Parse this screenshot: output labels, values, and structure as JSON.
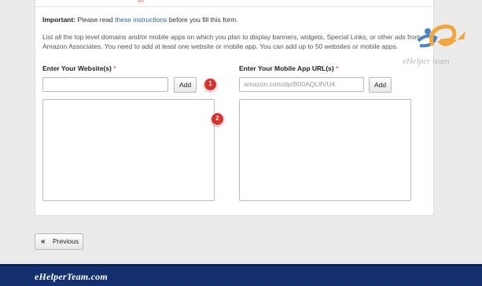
{
  "form": {
    "important_label": "Important:",
    "important_text_before": "Please read",
    "important_link": "these instructions",
    "important_text_after": "before you fill this form.",
    "desc_line1": "List all the top level domains and/or mobile apps on which you plan to display banners, widgets, Special Links, or other ads from",
    "desc_line2": "Amazon Associates. You need to add at least one website or mobile app. You can add up to 50 websites or mobile apps."
  },
  "websites": {
    "label": "Enter Your Website(s)",
    "required_mark": "*",
    "input_value": "",
    "add_label": "Add"
  },
  "mobile": {
    "label": "Enter Your Mobile App URL(s)",
    "required_mark": "*",
    "placeholder": "amazon.com/dp/B00AQL8VU4",
    "add_label": "Add"
  },
  "annotations": {
    "badge1": "1",
    "badge2": "2"
  },
  "nav": {
    "previous_icon": "«",
    "previous_label": "Previous"
  },
  "watermark": {
    "logo_text": "eHelper team",
    "icon": "ehelper-logo-icon"
  },
  "footer": {
    "brand": "eHelperTeam.com"
  },
  "colors": {
    "badge": "#d9302c",
    "link": "#2a6496",
    "footer_bg": "#15306e",
    "logo_blue": "#2f6fb5",
    "logo_orange": "#f39a1e"
  }
}
